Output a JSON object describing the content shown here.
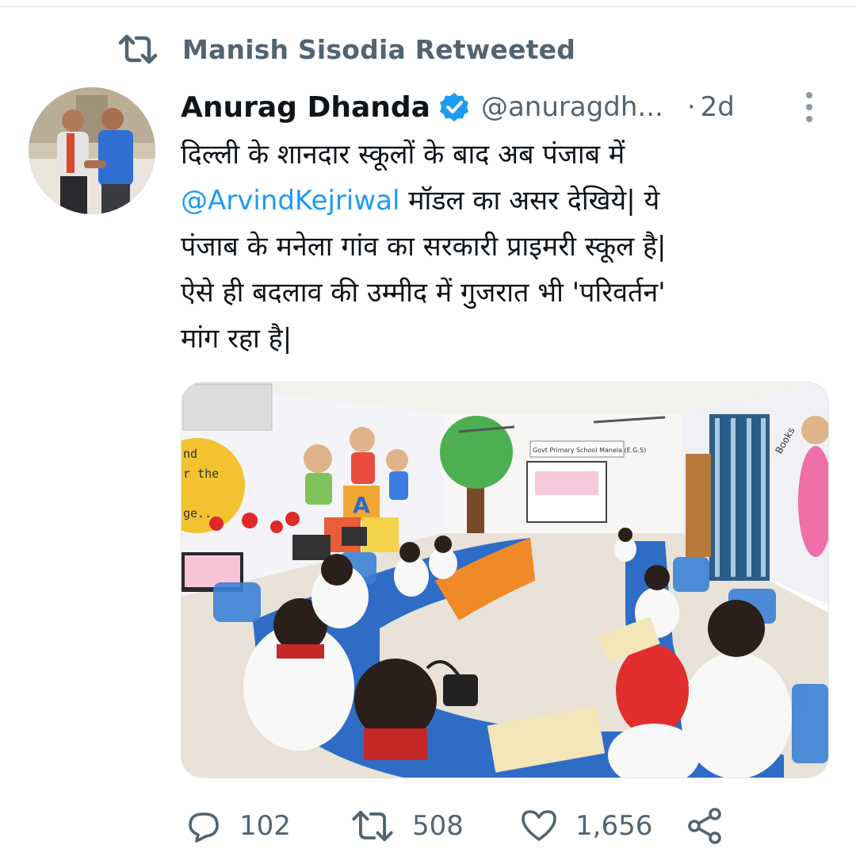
{
  "retweet_context": {
    "icon": "retweet-icon",
    "text": "Manish Sisodia Retweeted"
  },
  "tweet": {
    "author": {
      "name": "Anurag Dhanda",
      "verified_icon": "verified-badge-icon",
      "handle": "@anuragdh...",
      "avatar": "avatar-photo"
    },
    "separator": "·",
    "time": "2d",
    "more_icon": "more-options-icon",
    "text_lines": {
      "line1": "दिल्ली के शानदार स्कूलों के बाद अब पंजाब में",
      "mention": "@ArvindKejriwal",
      "line2_rest": " मॉडल का असर देखिये| ये",
      "line3": "पंजाब के मनेला गांव का सरकारी प्राइमरी स्कूल है|",
      "line4": "ऐसे ही बदलाव की उम्मीद में गुजरात भी 'परिवर्तन'",
      "line5": "मांग रहा है|"
    },
    "media": {
      "description_icon": "classroom-photo",
      "wall_text_left": "nd\nr the\nge..",
      "sign_text": "Govt Primary School Manela (E.G.S)",
      "wall_text_right": "Books are our true friends"
    },
    "actions": {
      "reply": {
        "icon": "reply-icon",
        "count": "102"
      },
      "retweet": {
        "icon": "retweet-icon",
        "count": "508"
      },
      "like": {
        "icon": "heart-icon",
        "count": "1,656"
      },
      "share": {
        "icon": "share-icon"
      }
    }
  },
  "colors": {
    "primary_text": "#0f1419",
    "secondary_text": "#536471",
    "link": "#1d9bf0",
    "verified": "#1d9bf0"
  }
}
